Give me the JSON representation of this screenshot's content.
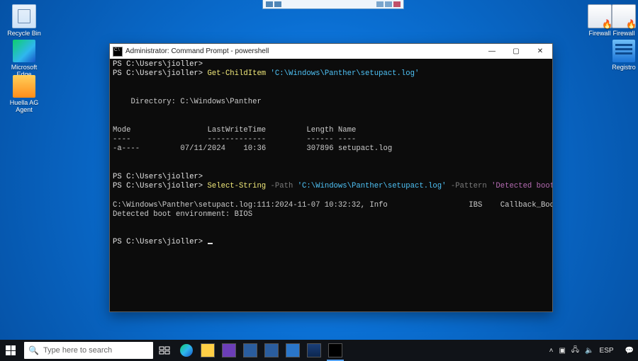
{
  "desktop": {
    "icons": [
      {
        "label": "Recycle Bin"
      },
      {
        "label": "Microsoft Edge"
      },
      {
        "label": "Huella AG Agent"
      },
      {
        "label": "Firewall"
      },
      {
        "label": "Firewall"
      },
      {
        "label": "Registro"
      }
    ]
  },
  "terminal": {
    "title": "Administrator: Command Prompt - powershell",
    "prompt": "PS C:\\Users\\jioller>",
    "cmd1_verb": "Get-ChildItem",
    "cmd1_arg": "'C:\\Windows\\Panther\\setupact.log'",
    "dir_label": "Directory: C:\\Windows\\Panther",
    "cols": {
      "mode": "Mode",
      "lwt": "LastWriteTime",
      "len": "Length",
      "name": "Name"
    },
    "row": {
      "mode": "-a----",
      "date": "07/11/2024",
      "time": "10:36",
      "len": "307896",
      "name": "setupact.log"
    },
    "cmd2_verb": "Select-String",
    "cmd2_p1": "-Path",
    "cmd2_arg1": "'C:\\Windows\\Panther\\setupact.log'",
    "cmd2_p2": "-Pattern",
    "cmd2_arg2": "'Detected boot environment'",
    "result_a": "C:\\Windows\\Panther\\setupact.log:111:2024-11-07 10:32:32, Info                  IBS    Callback_BootEnvironmentDetect:",
    "result_b": "Detected boot environment: BIOS"
  },
  "taskbar": {
    "search_placeholder": "Type here to search",
    "lang": "ESP",
    "time": "",
    "date": ""
  }
}
